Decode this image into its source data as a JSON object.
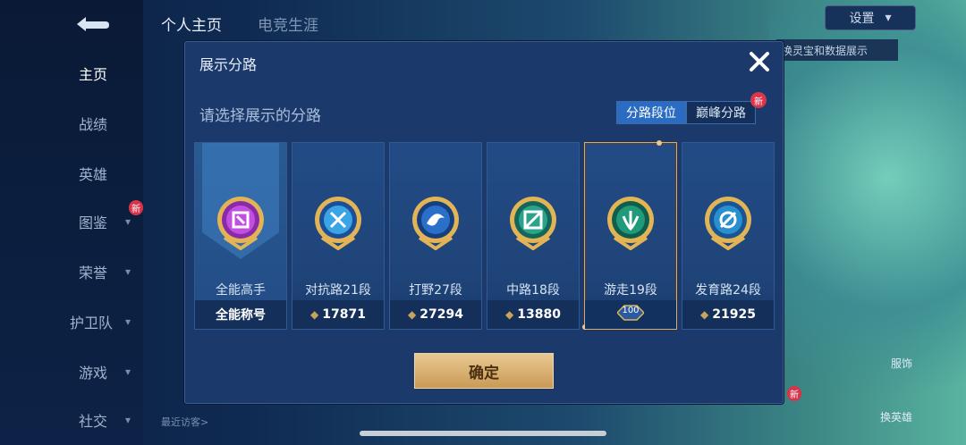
{
  "sidebar": {
    "items": [
      {
        "label": "主页"
      },
      {
        "label": "战绩"
      },
      {
        "label": "英雄"
      },
      {
        "label": "图鉴"
      },
      {
        "label": "荣誉"
      },
      {
        "label": "护卫队"
      },
      {
        "label": "游戏"
      },
      {
        "label": "社交"
      }
    ],
    "new_badge": "新"
  },
  "header": {
    "tabs": [
      "个人主页",
      "电竞生涯"
    ],
    "settings_label": "设置",
    "hint": "换灵宝和数据展示"
  },
  "bottom": {
    "recent_visitors": "最近访客>",
    "right_btn_1": "服饰",
    "right_btn_2": "换英雄",
    "new_badge": "新"
  },
  "modal": {
    "title": "展示分路",
    "subtitle": "请选择展示的分路",
    "tabs": [
      {
        "label": "分路段位",
        "active": true
      },
      {
        "label": "巅峰分路",
        "active": false
      }
    ],
    "tab_new_badge": "新",
    "confirm_label": "确定",
    "cards": [
      {
        "label": "全能高手",
        "value": "全能称号",
        "icon": "all-round-emblem",
        "color": "#b23ad0"
      },
      {
        "label": "对抗路21段",
        "value": "17871",
        "icon": "clash-lane-emblem",
        "color": "#2a8fd8"
      },
      {
        "label": "打野27段",
        "value": "27294",
        "icon": "jungle-emblem",
        "color": "#2b6fc8"
      },
      {
        "label": "中路18段",
        "value": "13880",
        "icon": "mid-lane-emblem",
        "color": "#2aa38a"
      },
      {
        "label": "游走19段",
        "value": "100",
        "icon": "roam-emblem",
        "color": "#1f9a7b",
        "selected": true
      },
      {
        "label": "发育路24段",
        "value": "21925",
        "icon": "farm-lane-emblem",
        "color": "#2a8fd0"
      }
    ]
  }
}
